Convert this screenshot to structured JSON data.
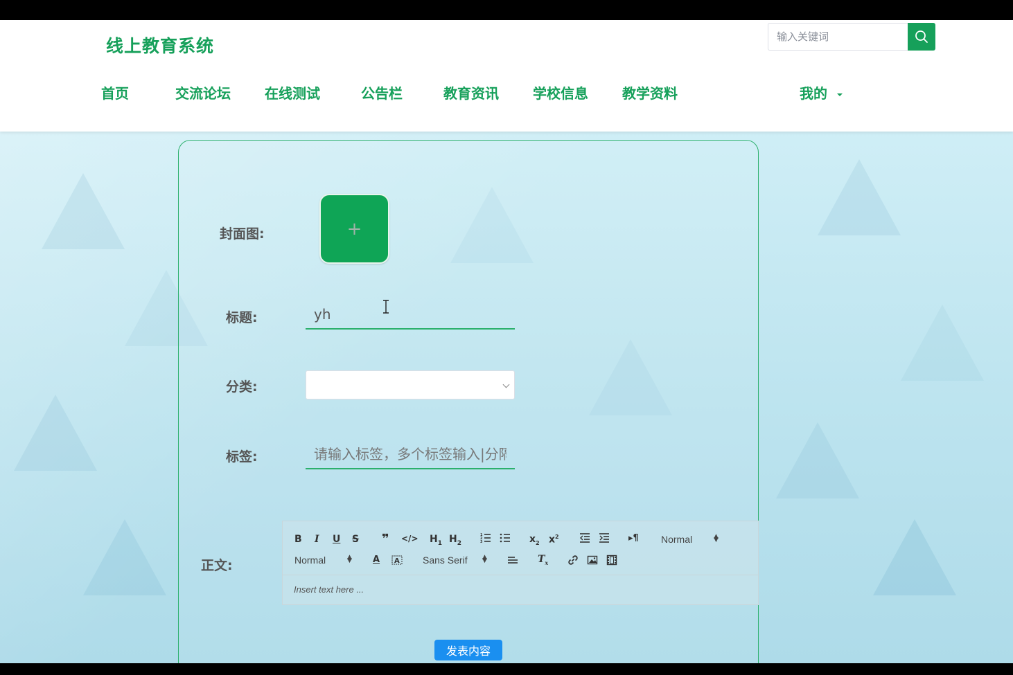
{
  "header": {
    "logo": "线上教育系统",
    "search": {
      "placeholder": "输入关键词",
      "value": ""
    }
  },
  "nav": {
    "items": [
      {
        "label": "首页"
      },
      {
        "label": "交流论坛"
      },
      {
        "label": "在线测试"
      },
      {
        "label": "公告栏"
      },
      {
        "label": "教育资讯"
      },
      {
        "label": "学校信息"
      },
      {
        "label": "教学资料"
      }
    ],
    "user_menu": "我的"
  },
  "form": {
    "cover_label": "封面图:",
    "cover_plus": "+",
    "title_label": "标题:",
    "title_value": "yh",
    "category_label": "分类:",
    "category_value": "",
    "tags_label": "标签:",
    "tags_placeholder": "请输入标签，多个标签输入|分隔",
    "body_label": "正文:",
    "editor": {
      "header_select": "Normal",
      "size_select": "Normal",
      "font_select": "Sans Serif",
      "placeholder": "Insert text here ..."
    },
    "submit_label": "发表内容"
  },
  "colors": {
    "brand": "#16a05a",
    "submit": "#1a8ff0"
  }
}
